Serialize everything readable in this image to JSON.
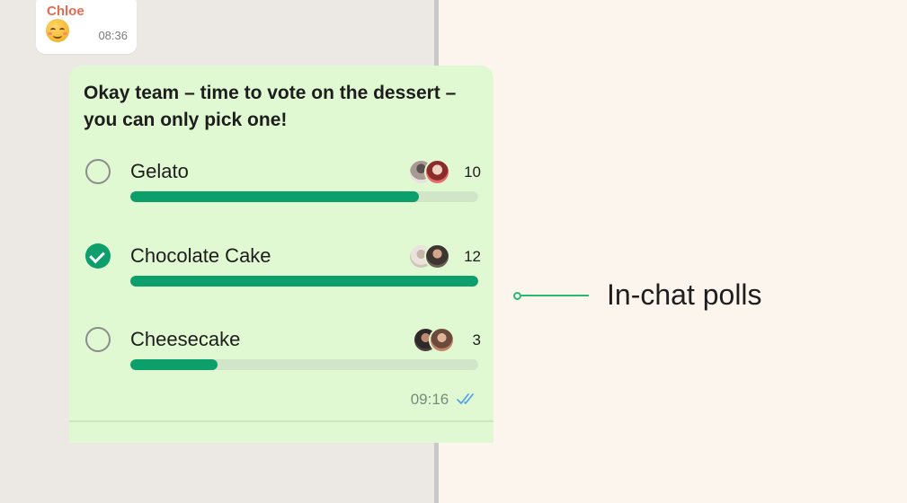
{
  "chat": {
    "incoming": {
      "sender": "Chloe",
      "emoji": "smiling-face-with-blush-emoji",
      "time": "08:36"
    },
    "poll": {
      "question": "Okay team – time to vote on the dessert – you can only pick one!",
      "options": [
        {
          "label": "Gelato",
          "votes": "10",
          "selected": false,
          "fill_fraction": 0.83
        },
        {
          "label": "Chocolate Cake",
          "votes": "12",
          "selected": true,
          "fill_fraction": 1.0
        },
        {
          "label": "Cheesecake",
          "votes": "3",
          "selected": false,
          "fill_fraction": 0.25
        }
      ],
      "time": "09:16",
      "status_icon": "double-check-icon"
    }
  },
  "feature_callout": {
    "label": "In-chat polls"
  },
  "colors": {
    "accent": "#0c9e6b",
    "bubble": "#e1f9d3",
    "sender_name": "#e56b50",
    "background": "#fcf5ee",
    "callout_line": "#28b96f",
    "read_ticks": "#53a6e6"
  }
}
